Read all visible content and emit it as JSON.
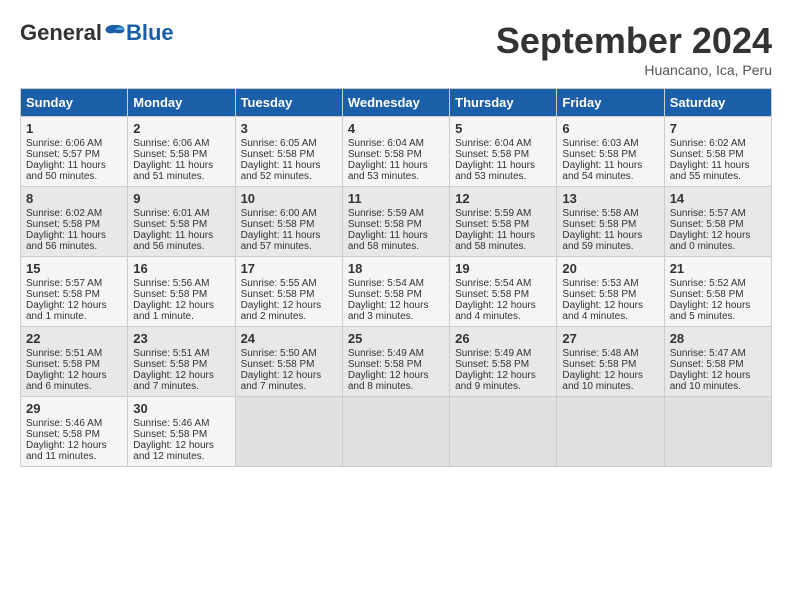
{
  "logo": {
    "general": "General",
    "blue": "Blue"
  },
  "title": "September 2024",
  "location": "Huancano, Ica, Peru",
  "days_header": [
    "Sunday",
    "Monday",
    "Tuesday",
    "Wednesday",
    "Thursday",
    "Friday",
    "Saturday"
  ],
  "weeks": [
    [
      {
        "day": "1",
        "info": "Sunrise: 6:06 AM\nSunset: 5:57 PM\nDaylight: 11 hours\nand 50 minutes."
      },
      {
        "day": "2",
        "info": "Sunrise: 6:06 AM\nSunset: 5:58 PM\nDaylight: 11 hours\nand 51 minutes."
      },
      {
        "day": "3",
        "info": "Sunrise: 6:05 AM\nSunset: 5:58 PM\nDaylight: 11 hours\nand 52 minutes."
      },
      {
        "day": "4",
        "info": "Sunrise: 6:04 AM\nSunset: 5:58 PM\nDaylight: 11 hours\nand 53 minutes."
      },
      {
        "day": "5",
        "info": "Sunrise: 6:04 AM\nSunset: 5:58 PM\nDaylight: 11 hours\nand 53 minutes."
      },
      {
        "day": "6",
        "info": "Sunrise: 6:03 AM\nSunset: 5:58 PM\nDaylight: 11 hours\nand 54 minutes."
      },
      {
        "day": "7",
        "info": "Sunrise: 6:02 AM\nSunset: 5:58 PM\nDaylight: 11 hours\nand 55 minutes."
      }
    ],
    [
      {
        "day": "8",
        "info": "Sunrise: 6:02 AM\nSunset: 5:58 PM\nDaylight: 11 hours\nand 56 minutes."
      },
      {
        "day": "9",
        "info": "Sunrise: 6:01 AM\nSunset: 5:58 PM\nDaylight: 11 hours\nand 56 minutes."
      },
      {
        "day": "10",
        "info": "Sunrise: 6:00 AM\nSunset: 5:58 PM\nDaylight: 11 hours\nand 57 minutes."
      },
      {
        "day": "11",
        "info": "Sunrise: 5:59 AM\nSunset: 5:58 PM\nDaylight: 11 hours\nand 58 minutes."
      },
      {
        "day": "12",
        "info": "Sunrise: 5:59 AM\nSunset: 5:58 PM\nDaylight: 11 hours\nand 58 minutes."
      },
      {
        "day": "13",
        "info": "Sunrise: 5:58 AM\nSunset: 5:58 PM\nDaylight: 11 hours\nand 59 minutes."
      },
      {
        "day": "14",
        "info": "Sunrise: 5:57 AM\nSunset: 5:58 PM\nDaylight: 12 hours\nand 0 minutes."
      }
    ],
    [
      {
        "day": "15",
        "info": "Sunrise: 5:57 AM\nSunset: 5:58 PM\nDaylight: 12 hours\nand 1 minute."
      },
      {
        "day": "16",
        "info": "Sunrise: 5:56 AM\nSunset: 5:58 PM\nDaylight: 12 hours\nand 1 minute."
      },
      {
        "day": "17",
        "info": "Sunrise: 5:55 AM\nSunset: 5:58 PM\nDaylight: 12 hours\nand 2 minutes."
      },
      {
        "day": "18",
        "info": "Sunrise: 5:54 AM\nSunset: 5:58 PM\nDaylight: 12 hours\nand 3 minutes."
      },
      {
        "day": "19",
        "info": "Sunrise: 5:54 AM\nSunset: 5:58 PM\nDaylight: 12 hours\nand 4 minutes."
      },
      {
        "day": "20",
        "info": "Sunrise: 5:53 AM\nSunset: 5:58 PM\nDaylight: 12 hours\nand 4 minutes."
      },
      {
        "day": "21",
        "info": "Sunrise: 5:52 AM\nSunset: 5:58 PM\nDaylight: 12 hours\nand 5 minutes."
      }
    ],
    [
      {
        "day": "22",
        "info": "Sunrise: 5:51 AM\nSunset: 5:58 PM\nDaylight: 12 hours\nand 6 minutes."
      },
      {
        "day": "23",
        "info": "Sunrise: 5:51 AM\nSunset: 5:58 PM\nDaylight: 12 hours\nand 7 minutes."
      },
      {
        "day": "24",
        "info": "Sunrise: 5:50 AM\nSunset: 5:58 PM\nDaylight: 12 hours\nand 7 minutes."
      },
      {
        "day": "25",
        "info": "Sunrise: 5:49 AM\nSunset: 5:58 PM\nDaylight: 12 hours\nand 8 minutes."
      },
      {
        "day": "26",
        "info": "Sunrise: 5:49 AM\nSunset: 5:58 PM\nDaylight: 12 hours\nand 9 minutes."
      },
      {
        "day": "27",
        "info": "Sunrise: 5:48 AM\nSunset: 5:58 PM\nDaylight: 12 hours\nand 10 minutes."
      },
      {
        "day": "28",
        "info": "Sunrise: 5:47 AM\nSunset: 5:58 PM\nDaylight: 12 hours\nand 10 minutes."
      }
    ],
    [
      {
        "day": "29",
        "info": "Sunrise: 5:46 AM\nSunset: 5:58 PM\nDaylight: 12 hours\nand 11 minutes."
      },
      {
        "day": "30",
        "info": "Sunrise: 5:46 AM\nSunset: 5:58 PM\nDaylight: 12 hours\nand 12 minutes."
      },
      {
        "day": "",
        "info": ""
      },
      {
        "day": "",
        "info": ""
      },
      {
        "day": "",
        "info": ""
      },
      {
        "day": "",
        "info": ""
      },
      {
        "day": "",
        "info": ""
      }
    ]
  ]
}
